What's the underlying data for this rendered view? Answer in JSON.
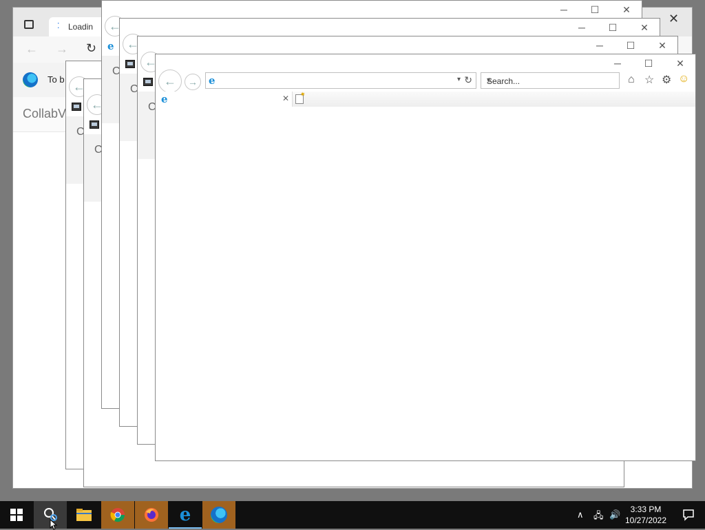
{
  "edge": {
    "tab_title": "Loadin",
    "info_text": "To b",
    "page_text": "CollabV"
  },
  "ie_windows": {
    "stub_letter": "C"
  },
  "front_ie": {
    "search_placeholder": "Search..."
  },
  "taskbar": {
    "time": "3:33 PM",
    "date": "10/27/2022"
  }
}
